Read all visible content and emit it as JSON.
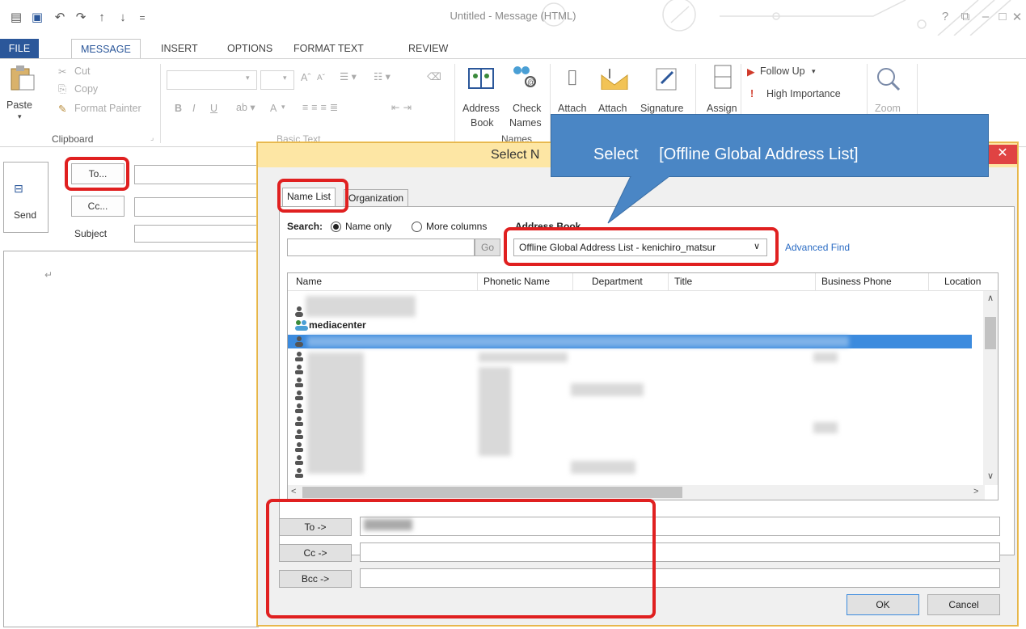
{
  "window": {
    "title": "Untitled - Message (HTML)",
    "help": "?",
    "restore": "⧉",
    "minimize": "–",
    "maximize": "□",
    "close": "✕"
  },
  "quick_access": [
    "▤",
    "💾",
    "↶",
    "↷",
    "↑",
    "↓",
    "="
  ],
  "tabs": [
    "FILE",
    "MESSAGE",
    "INSERT",
    "OPTIONS",
    "FORMAT TEXT",
    "REVIEW"
  ],
  "ribbon": {
    "clipboard": {
      "paste": "Paste",
      "cut": "Cut",
      "copy": "Copy",
      "format_painter": "Format Painter",
      "label": "Clipboard"
    },
    "basic_text": {
      "label": "Basic Text",
      "bold": "B",
      "italic": "I",
      "underline": "U",
      "font_grow": "Aˆ",
      "font_shrink": "Aˇ",
      "font_color": "A"
    },
    "names": {
      "address_book": "Address",
      "address_book_2": "Book",
      "check_names": "Check",
      "check_names_2": "Names",
      "label": "Names"
    },
    "include": {
      "attach_file": "Attach",
      "attach_item": "Attach",
      "signature": "Signature"
    },
    "assign": "Assign",
    "tags": {
      "follow_up": "Follow Up",
      "high_importance": "High Importance"
    },
    "zoom": "Zoom"
  },
  "compose": {
    "send": "Send",
    "to": "To...",
    "cc": "Cc...",
    "subject": "Subject",
    "body_mark": "↵"
  },
  "dialog": {
    "title": "Select N",
    "close": "✕",
    "tabs": [
      "Name List",
      "Organization"
    ],
    "search_label": "Search:",
    "name_only": "Name only",
    "more_columns": "More columns",
    "address_book_label": "Address Book",
    "go": "Go",
    "address_book_value": "Offline Global Address List - kenichiro_matsur",
    "advanced_find": "Advanced Find",
    "columns": [
      "Name",
      "Phonetic Name",
      "Department",
      "Title",
      "Business Phone",
      "Location"
    ],
    "visible_row_name": "mediacenter",
    "to_button": "To ->",
    "cc_button": "Cc ->",
    "bcc_button": "Bcc ->",
    "ok": "OK",
    "cancel": "Cancel"
  },
  "callout": {
    "text": "Select 　[Offline Global Address List]"
  }
}
